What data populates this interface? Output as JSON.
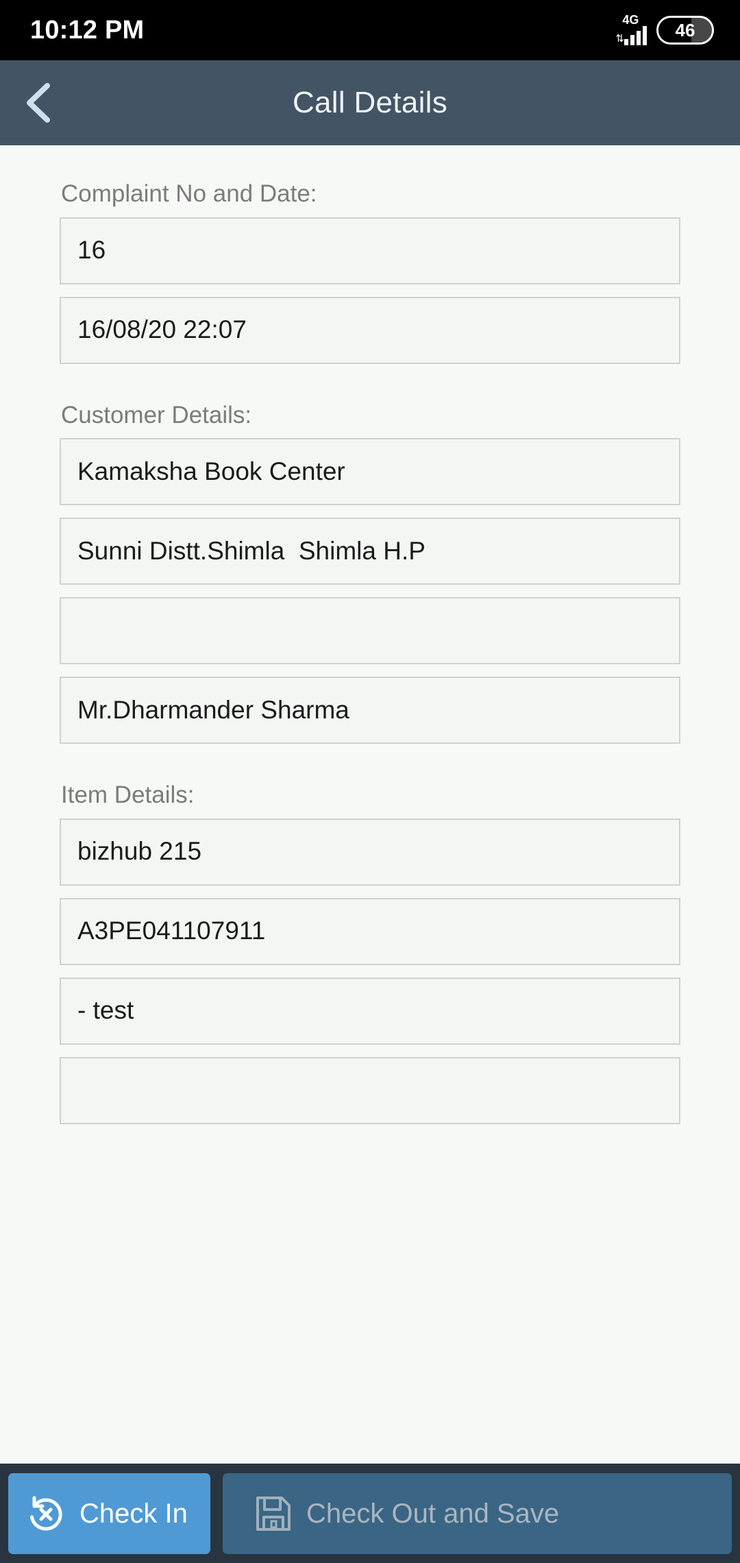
{
  "status_bar": {
    "clock": "10:12 PM",
    "network_type": "4G",
    "data_arrows_icon": "data-transfer-arrows-icon",
    "signal_icon": "signal-bars-icon",
    "battery_level": "46",
    "battery_icon": "battery-icon"
  },
  "appbar": {
    "back_icon": "back-chevron-icon",
    "title": "Call Details",
    "background": "#435464"
  },
  "sections": [
    {
      "label": "Complaint No and Date:",
      "fields": [
        {
          "name": "complaint-number-field",
          "value": "16"
        },
        {
          "name": "complaint-date-field",
          "value": "16/08/20 22:07"
        }
      ]
    },
    {
      "label": "Customer Details:",
      "fields": [
        {
          "name": "customer-name-field",
          "value": "Kamaksha Book Center"
        },
        {
          "name": "customer-address-field",
          "value": "Sunni Distt.Shimla  Shimla H.P"
        },
        {
          "name": "customer-phone-field",
          "value": ""
        },
        {
          "name": "customer-contact-person-field",
          "value": "Mr.Dharmander Sharma"
        }
      ]
    },
    {
      "label": "Item Details:",
      "fields": [
        {
          "name": "item-model-field",
          "value": "bizhub 215"
        },
        {
          "name": "item-serial-field",
          "value": "A3PE041107911"
        },
        {
          "name": "item-problem-field",
          "value": "- test"
        },
        {
          "name": "item-remarks-field",
          "value": ""
        }
      ]
    }
  ],
  "bottom_bar": {
    "background": "#283540",
    "check_in": {
      "label": "Check In",
      "icon": "check-in-circular-x-icon",
      "color": "#4f9ad4",
      "enabled": true
    },
    "check_out": {
      "label": "Check Out and Save",
      "icon": "save-floppy-disk-icon",
      "color": "#3b6584",
      "enabled": false
    }
  }
}
